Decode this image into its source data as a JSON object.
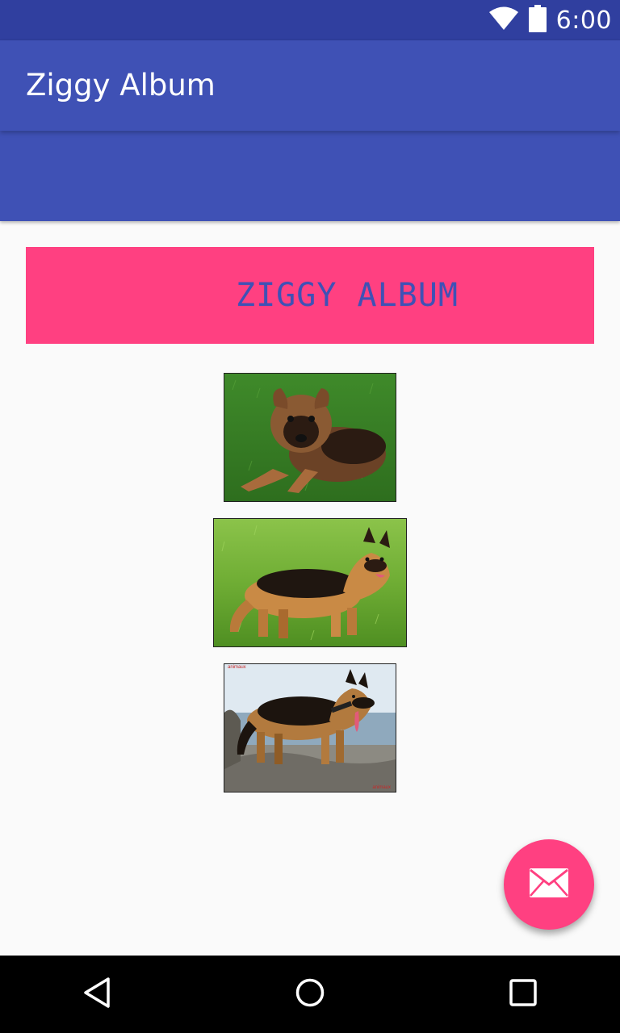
{
  "status_bar": {
    "time": "6:00",
    "icons": [
      "wifi-icon",
      "battery-icon"
    ],
    "color": "#303f9f"
  },
  "app_bar": {
    "title": "Ziggy Album",
    "color": "#3f51b5"
  },
  "content": {
    "banner": {
      "text": "ZIGGY ALBUM",
      "background": "#ff4081",
      "text_color": "#3f51b5"
    },
    "photos": [
      {
        "name": "puppy-photo",
        "caption": ""
      },
      {
        "name": "dog-on-grass-photo",
        "caption": ""
      },
      {
        "name": "dog-on-rocks-photo",
        "caption_top": "animaux",
        "caption": "animaux"
      }
    ]
  },
  "fab": {
    "icon": "email-icon",
    "color": "#ff4081"
  },
  "nav_bar": {
    "icons": [
      "back-icon",
      "home-icon",
      "recent-apps-icon"
    ]
  }
}
